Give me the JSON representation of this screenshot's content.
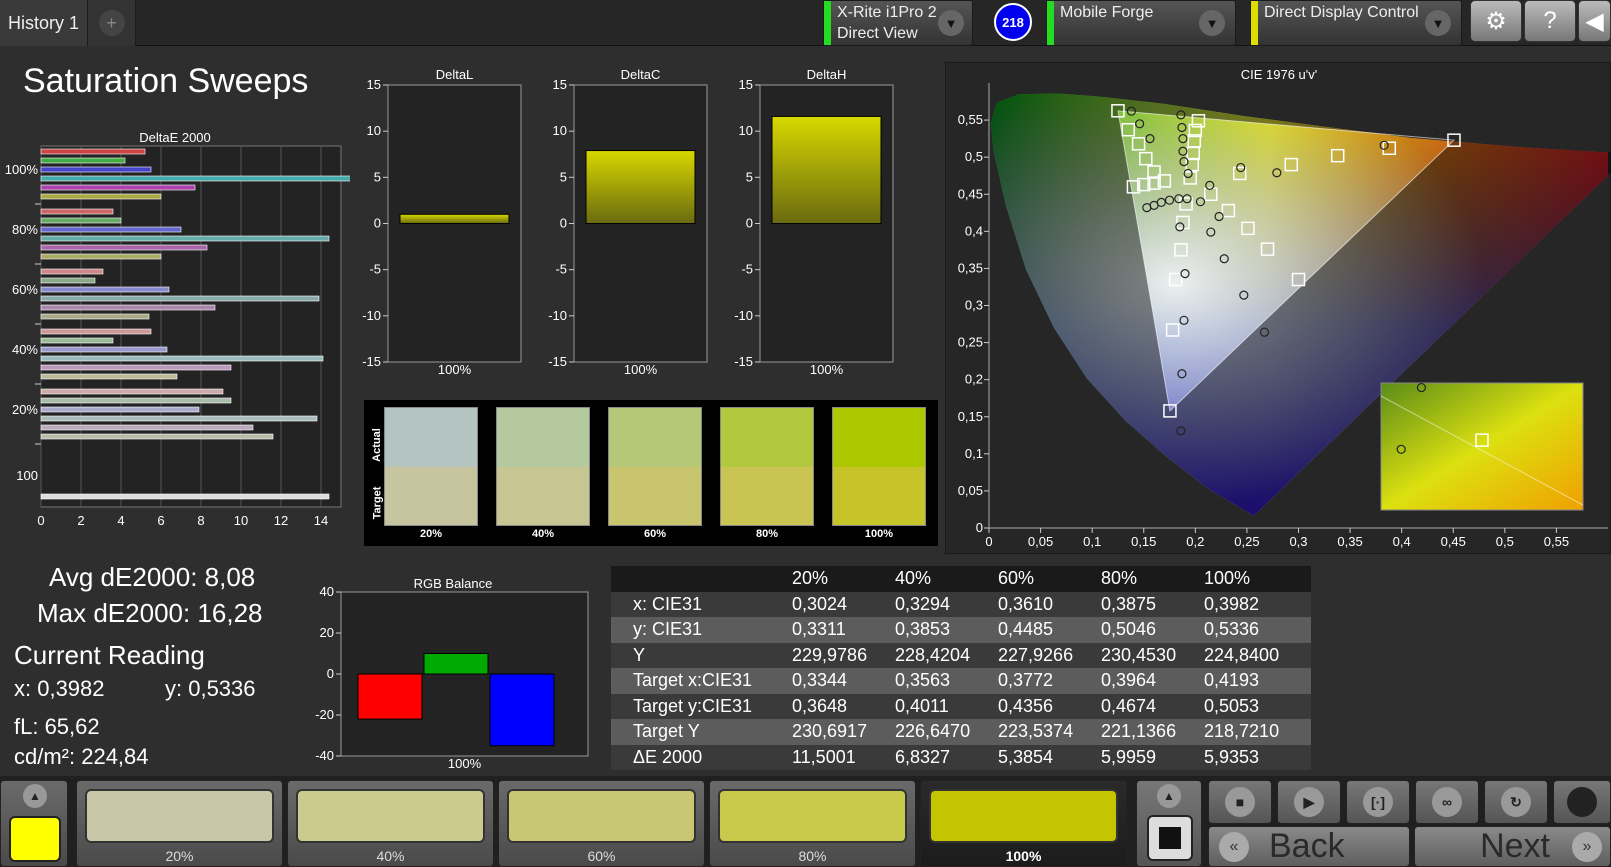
{
  "tab": {
    "label": "History 1",
    "add": "+"
  },
  "devices": [
    {
      "line1": "X-Rite i1Pro 2",
      "line2": "Direct View",
      "color": "#22dd22"
    },
    {
      "line1": "Mobile Forge",
      "line2": "",
      "color": "#22dd22"
    },
    {
      "line1": "Direct Display Control",
      "line2": "",
      "color": "#dddd00"
    }
  ],
  "badge": "218",
  "page_title": "Saturation Sweeps",
  "stats": {
    "avg": "Avg dE2000: 8,08",
    "max": "Max dE2000: 16,28",
    "current_label": "Current Reading",
    "x": "x: 0,3982",
    "y": "y: 0,5336",
    "fl": "fL: 65,62",
    "cdm": "cd/m²: 224,84"
  },
  "chart_data": [
    {
      "type": "bar",
      "title": "DeltaE 2000",
      "orientation": "horizontal",
      "xlim": [
        0,
        15
      ],
      "xticks": [
        "0",
        "2",
        "4",
        "6",
        "8",
        "10",
        "12",
        "14"
      ],
      "categories": [
        "100%",
        "80%",
        "60%",
        "40%",
        "20%",
        "100"
      ],
      "groups": [
        {
          "category": "100%",
          "values": [
            5.2,
            4.2,
            5.5,
            16.3,
            7.7,
            6.0
          ],
          "colors": [
            "#cc4444",
            "#44aa44",
            "#4444cc",
            "#44aaaa",
            "#aa44aa",
            "#aaaa44"
          ]
        },
        {
          "category": "80%",
          "values": [
            3.6,
            4.0,
            7.0,
            14.4,
            8.3,
            6.0
          ],
          "colors": [
            "#cc6666",
            "#66aa66",
            "#6666cc",
            "#66aaaa",
            "#aa66aa",
            "#aaaa66"
          ]
        },
        {
          "category": "60%",
          "values": [
            3.1,
            2.7,
            6.4,
            13.9,
            8.7,
            5.4
          ],
          "colors": [
            "#cc8888",
            "#88aa88",
            "#8888cc",
            "#88aaaa",
            "#aa88aa",
            "#aaaa88"
          ]
        },
        {
          "category": "40%",
          "values": [
            5.5,
            3.6,
            6.3,
            14.1,
            9.5,
            6.8
          ],
          "colors": [
            "#cc9999",
            "#99bb99",
            "#9999cc",
            "#99bbbb",
            "#bb99bb",
            "#bbbb99"
          ]
        },
        {
          "category": "20%",
          "values": [
            9.1,
            9.5,
            7.9,
            13.8,
            10.6,
            11.6
          ],
          "colors": [
            "#ccaaaa",
            "#aabbaa",
            "#aaaacc",
            "#aabbbb",
            "#bbaabb",
            "#bbbbaa"
          ]
        },
        {
          "category": "100",
          "values": [
            14.4
          ],
          "colors": [
            "#dddddd"
          ]
        }
      ]
    },
    {
      "type": "bar",
      "title": "DeltaL",
      "categories": [
        "100%"
      ],
      "values": [
        1.0
      ],
      "ylim": [
        -15,
        15
      ],
      "yticks": [
        "15",
        "10",
        "5",
        "0",
        "-5",
        "-10",
        "-15"
      ]
    },
    {
      "type": "bar",
      "title": "DeltaC",
      "categories": [
        "100%"
      ],
      "values": [
        7.9
      ],
      "ylim": [
        -15,
        15
      ],
      "yticks": [
        "15",
        "10",
        "5",
        "0",
        "-5",
        "-10",
        "-15"
      ]
    },
    {
      "type": "bar",
      "title": "DeltaH",
      "categories": [
        "100%"
      ],
      "values": [
        11.6
      ],
      "ylim": [
        -15,
        15
      ],
      "yticks": [
        "15",
        "10",
        "5",
        "0",
        "-5",
        "-10",
        "-15"
      ]
    },
    {
      "type": "bar",
      "title": "RGB Balance",
      "categories": [
        "100%"
      ],
      "series": [
        {
          "color": "#ff0000",
          "value": -22
        },
        {
          "color": "#00aa00",
          "value": 10
        },
        {
          "color": "#0000ff",
          "value": -35
        }
      ],
      "ylim": [
        -40,
        40
      ],
      "yticks": [
        "40",
        "20",
        "0",
        "-20",
        "-40"
      ]
    },
    {
      "type": "scatter",
      "title": "CIE 1976 u'v'",
      "xlim": [
        0,
        0.6
      ],
      "ylim": [
        0,
        0.6
      ],
      "xticks": [
        "0",
        "0,05",
        "0,1",
        "0,15",
        "0,2",
        "0,25",
        "0,3",
        "0,35",
        "0,4",
        "0,45",
        "0,5",
        "0,55"
      ],
      "yticks": [
        "0",
        "0,05",
        "0,1",
        "0,15",
        "0,2",
        "0,25",
        "0,3",
        "0,35",
        "0,4",
        "0,45",
        "0,5",
        "0,55"
      ],
      "gamut": [
        [
          0.125,
          0.5625
        ],
        [
          0.4507,
          0.5229
        ],
        [
          0.1754,
          0.1579
        ]
      ],
      "targets": [
        [
          0.125,
          0.5625
        ],
        [
          0.135,
          0.537
        ],
        [
          0.145,
          0.518
        ],
        [
          0.152,
          0.498
        ],
        [
          0.16,
          0.48
        ],
        [
          0.14,
          0.46
        ],
        [
          0.15,
          0.463
        ],
        [
          0.16,
          0.465
        ],
        [
          0.17,
          0.468
        ],
        [
          0.195,
          0.472
        ],
        [
          0.243,
          0.478
        ],
        [
          0.293,
          0.49
        ],
        [
          0.338,
          0.502
        ],
        [
          0.388,
          0.512
        ],
        [
          0.4507,
          0.5229
        ],
        [
          0.203,
          0.549
        ],
        [
          0.2,
          0.536
        ],
        [
          0.199,
          0.522
        ],
        [
          0.198,
          0.505
        ],
        [
          0.197,
          0.49
        ],
        [
          0.215,
          0.45
        ],
        [
          0.232,
          0.428
        ],
        [
          0.251,
          0.404
        ],
        [
          0.27,
          0.376
        ],
        [
          0.3,
          0.335
        ],
        [
          0.191,
          0.437
        ],
        [
          0.188,
          0.412
        ],
        [
          0.186,
          0.375
        ],
        [
          0.181,
          0.335
        ],
        [
          0.178,
          0.267
        ],
        [
          0.1754,
          0.1579
        ]
      ],
      "measured": [
        [
          0.138,
          0.562
        ],
        [
          0.146,
          0.545
        ],
        [
          0.156,
          0.525
        ],
        [
          0.186,
          0.557
        ],
        [
          0.187,
          0.54
        ],
        [
          0.188,
          0.525
        ],
        [
          0.188,
          0.508
        ],
        [
          0.189,
          0.494
        ],
        [
          0.193,
          0.478
        ],
        [
          0.214,
          0.462
        ],
        [
          0.244,
          0.486
        ],
        [
          0.279,
          0.479
        ],
        [
          0.383,
          0.516
        ],
        [
          0.431,
          0.534
        ],
        [
          0.153,
          0.432
        ],
        [
          0.16,
          0.435
        ],
        [
          0.167,
          0.439
        ],
        [
          0.175,
          0.442
        ],
        [
          0.184,
          0.444
        ],
        [
          0.192,
          0.444
        ],
        [
          0.205,
          0.44
        ],
        [
          0.223,
          0.42
        ],
        [
          0.185,
          0.406
        ],
        [
          0.215,
          0.399
        ],
        [
          0.228,
          0.363
        ],
        [
          0.19,
          0.343
        ],
        [
          0.247,
          0.314
        ],
        [
          0.189,
          0.28
        ],
        [
          0.267,
          0.264
        ],
        [
          0.187,
          0.208
        ],
        [
          0.186,
          0.131
        ]
      ],
      "inset_measured": [
        [
          0.2,
          0.55
        ],
        [
          0.1,
          0.1
        ]
      ],
      "inset_target": [
        [
          0.2,
          0.5
        ]
      ]
    }
  ],
  "swatch_panel": {
    "actual_label": "Actual",
    "target_label": "Target",
    "items": [
      {
        "label": "20%",
        "actual": "#b4c5c1",
        "target": "#c7c59f"
      },
      {
        "label": "40%",
        "actual": "#b4c99e",
        "target": "#c7c592"
      },
      {
        "label": "60%",
        "actual": "#b5c877",
        "target": "#c9c56f"
      },
      {
        "label": "80%",
        "actual": "#b2c93f",
        "target": "#cac452"
      },
      {
        "label": "100%",
        "actual": "#aec800",
        "target": "#c7c42a"
      }
    ]
  },
  "delta_label": "100%",
  "rgb_label": "100%",
  "table": {
    "header": [
      "",
      "20%",
      "40%",
      "60%",
      "80%",
      "100%"
    ],
    "rows": [
      [
        "x: CIE31",
        "0,3024",
        "0,3294",
        "0,3610",
        "0,3875",
        "0,3982"
      ],
      [
        "y: CIE31",
        "0,3311",
        "0,3853",
        "0,4485",
        "0,5046",
        "0,5336"
      ],
      [
        "Y",
        "229,9786",
        "228,4204",
        "227,9266",
        "230,4530",
        "224,8400"
      ],
      [
        "Target x:CIE31",
        "0,3344",
        "0,3563",
        "0,3772",
        "0,3964",
        "0,4193"
      ],
      [
        "Target y:CIE31",
        "0,3648",
        "0,4011",
        "0,4356",
        "0,4674",
        "0,5053"
      ],
      [
        "Target Y",
        "230,6917",
        "226,6470",
        "223,5374",
        "221,1366",
        "218,7210"
      ],
      [
        "ΔE 2000",
        "11,5001",
        "6,8327",
        "5,3854",
        "5,9959",
        "5,9353"
      ]
    ]
  },
  "bottom": {
    "current_color": "#ffff00",
    "swatches": [
      {
        "label": "20%",
        "color": "#c8c8a8"
      },
      {
        "label": "40%",
        "color": "#cacb8c"
      },
      {
        "label": "60%",
        "color": "#c8c872"
      },
      {
        "label": "80%",
        "color": "#c8c84a"
      },
      {
        "label": "100%",
        "color": "#c4c400"
      }
    ],
    "back": "Back",
    "next": "Next"
  }
}
